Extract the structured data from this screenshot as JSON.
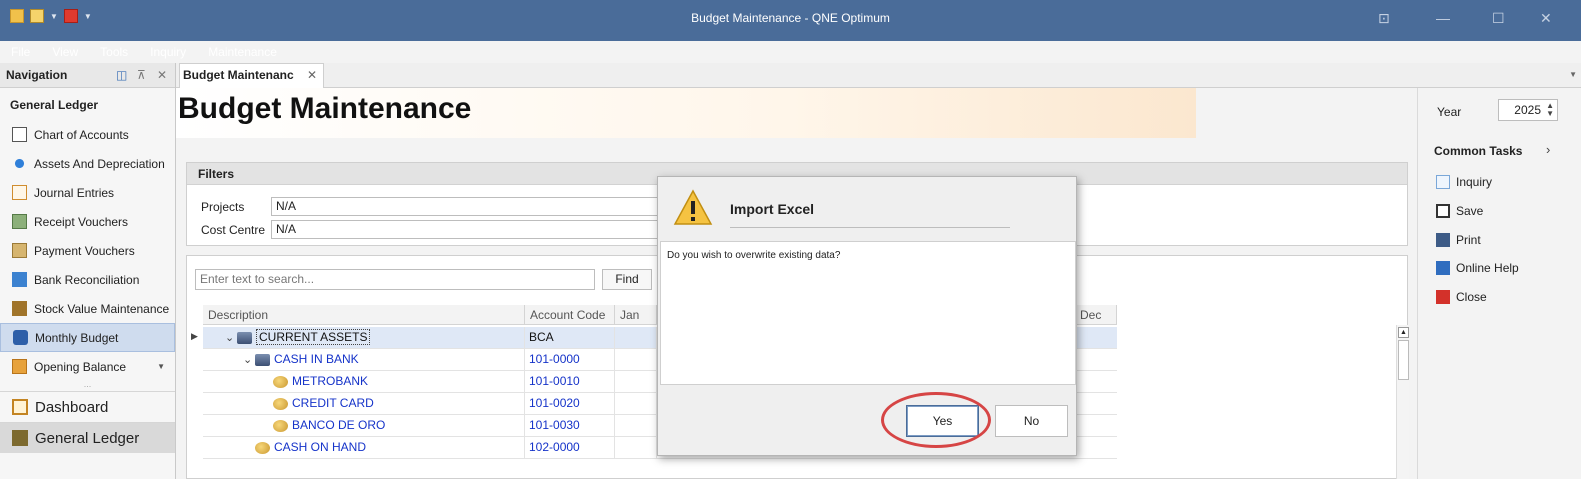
{
  "window": {
    "title": "Budget Maintenance - QNE Optimum",
    "controls": [
      "⊡",
      "—",
      "☐",
      "✕"
    ]
  },
  "menu": [
    "File",
    "View",
    "Tools",
    "Inquiry",
    "Maintenance"
  ],
  "navigation": {
    "header": "Navigation",
    "section": "General Ledger",
    "items": [
      {
        "label": "Chart of Accounts",
        "icon": "book-icon"
      },
      {
        "label": "Assets And Depreciation",
        "icon": "gear-icon"
      },
      {
        "label": "Journal Entries",
        "icon": "journal-icon"
      },
      {
        "label": "Receipt Vouchers",
        "icon": "receipt-icon"
      },
      {
        "label": "Payment Vouchers",
        "icon": "payment-icon"
      },
      {
        "label": "Bank Reconciliation",
        "icon": "bank-icon"
      },
      {
        "label": "Stock Value Maintenance",
        "icon": "stock-icon"
      },
      {
        "label": "Monthly Budget",
        "icon": "budget-icon",
        "active": true
      },
      {
        "label": "Opening Balance",
        "icon": "balance-icon"
      }
    ],
    "dots": "...",
    "modules": [
      {
        "label": "Dashboard",
        "icon": "dashboard-icon"
      },
      {
        "label": "General Ledger",
        "icon": "general-ledger-icon",
        "active": true
      }
    ]
  },
  "document_tab": {
    "label": "Budget Maintenanc",
    "close": "✕"
  },
  "page": {
    "title": "Budget Maintenance"
  },
  "filters": {
    "header": "Filters",
    "projects_label": "Projects",
    "projects_value": "N/A",
    "cost_centre_label": "Cost Centre",
    "cost_centre_value": "N/A"
  },
  "grid": {
    "search_placeholder": "Enter text to search...",
    "find_label": "Find",
    "columns": {
      "description": "Description",
      "account_code": "Account Code",
      "jan": "Jan",
      "dec": "Dec"
    },
    "rows": [
      {
        "description": "CURRENT ASSETS",
        "code": "BCA",
        "level": 0,
        "icon": "stack",
        "expanded": true,
        "selected": true
      },
      {
        "description": "CASH IN BANK",
        "code": "101-0000",
        "level": 1,
        "icon": "stack",
        "expanded": true
      },
      {
        "description": "METROBANK",
        "code": "101-0010",
        "level": 2,
        "icon": "coin"
      },
      {
        "description": "CREDIT CARD",
        "code": "101-0020",
        "level": 2,
        "icon": "coin"
      },
      {
        "description": "BANCO DE ORO",
        "code": "101-0030",
        "level": 2,
        "icon": "coin"
      },
      {
        "description": "CASH ON HAND",
        "code": "102-0000",
        "level": 1,
        "icon": "coin"
      }
    ]
  },
  "right_panel": {
    "year_label": "Year",
    "year_value": "2025",
    "common_tasks": "Common Tasks",
    "tasks": [
      {
        "label": "Inquiry",
        "icon": "inquiry-icon"
      },
      {
        "label": "Save",
        "icon": "save-icon"
      },
      {
        "label": "Print",
        "icon": "print-icon"
      },
      {
        "label": "Online Help",
        "icon": "help-icon"
      },
      {
        "label": "Close",
        "icon": "close-icon"
      }
    ]
  },
  "dialog": {
    "title": "Import Excel",
    "message": "Do you wish to overwrite existing data?",
    "yes_label": "Yes",
    "no_label": "No",
    "icon": "warning-icon"
  },
  "colors": {
    "titlebar": "#4a6c99",
    "highlight": "#d64545",
    "link": "#1533c9"
  }
}
